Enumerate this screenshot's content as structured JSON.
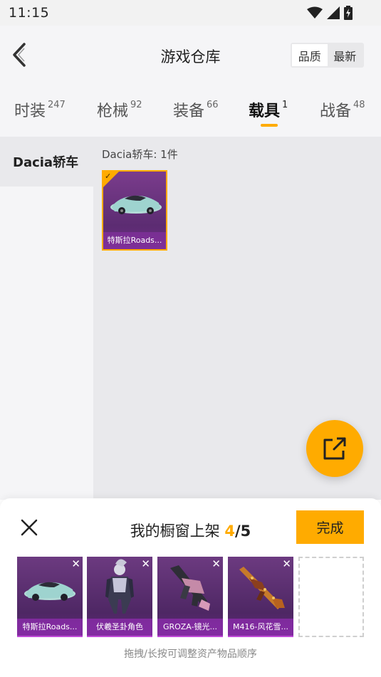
{
  "status_bar": {
    "time": "11:15"
  },
  "header": {
    "title": "游戏仓库",
    "sort_options": [
      "品质",
      "最新"
    ],
    "active_sort": "品质"
  },
  "tabs": [
    {
      "label": "时装",
      "count": "247"
    },
    {
      "label": "枪械",
      "count": "92"
    },
    {
      "label": "装备",
      "count": "66"
    },
    {
      "label": "载具",
      "count": "1",
      "active": true
    },
    {
      "label": "战备",
      "count": "48"
    }
  ],
  "sidebar": {
    "items": [
      {
        "label": "Dacia轿车",
        "active": true
      }
    ]
  },
  "content": {
    "section_title": "Dacia轿车: 1件",
    "items": [
      {
        "name": "特斯拉Roads...",
        "selected": true
      }
    ]
  },
  "sheet": {
    "title": "我的橱窗上架",
    "current": "4",
    "separator": "/",
    "max": "5",
    "done_label": "完成",
    "slots": [
      {
        "name": "特斯拉Roads..."
      },
      {
        "name": "伏羲圣卦角色"
      },
      {
        "name": "GROZA-镜光..."
      },
      {
        "name": "M416-风花雪..."
      }
    ],
    "hint": "拖拽/长按可调整资产物品顺序"
  },
  "colors": {
    "accent": "#ffab00",
    "item_purple": "#6c3a80"
  }
}
